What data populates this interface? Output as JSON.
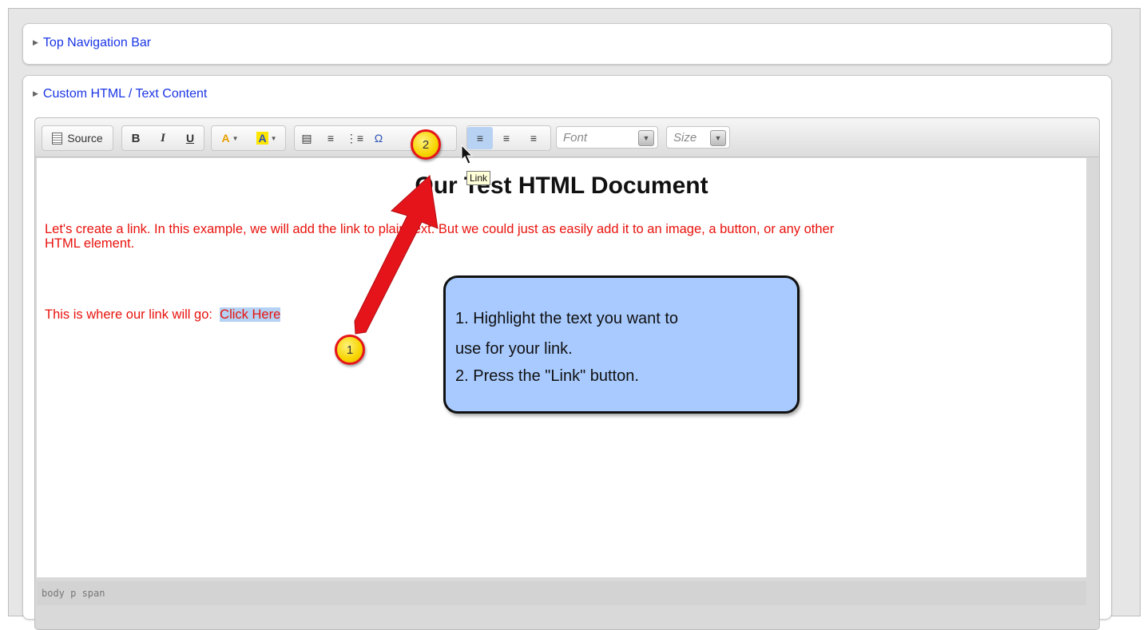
{
  "panels": {
    "top_nav": {
      "title": "Top Navigation Bar"
    },
    "custom_html": {
      "title": "Custom HTML / Text Content"
    }
  },
  "toolbar": {
    "source_label": "Source",
    "bold_label": "B",
    "italic_label": "I",
    "underline_label": "U",
    "text_color_label": "A",
    "bg_color_label": "A",
    "font_placeholder": "Font",
    "size_placeholder": "Size"
  },
  "tooltip": "Link",
  "document": {
    "heading": "Our Test HTML Document",
    "paragraph1": "Let's create a link.  In this example, we will add the link to plain text.  But we could just as easily add it to an image, a button, or any other",
    "paragraph1_line2": "HTML element.",
    "paragraph2_prefix": "This is where our link will go:  ",
    "paragraph2_selected": "Click Here"
  },
  "statusbar": {
    "path": "body  p  span"
  },
  "callout": {
    "line1": "1.  Highlight the text you want to",
    "line2": "use for your link.",
    "line3": "2.  Press the \"Link\" button."
  },
  "markers": {
    "step1": "1",
    "step2": "2"
  },
  "colors": {
    "link_blue": "#1a35e6",
    "doc_text_red": "#e8120c",
    "selection": "#b4d2f4",
    "callout_fill": "#a8caff",
    "arrow_red": "#e5141a",
    "marker_yellow": "#f7d400"
  }
}
